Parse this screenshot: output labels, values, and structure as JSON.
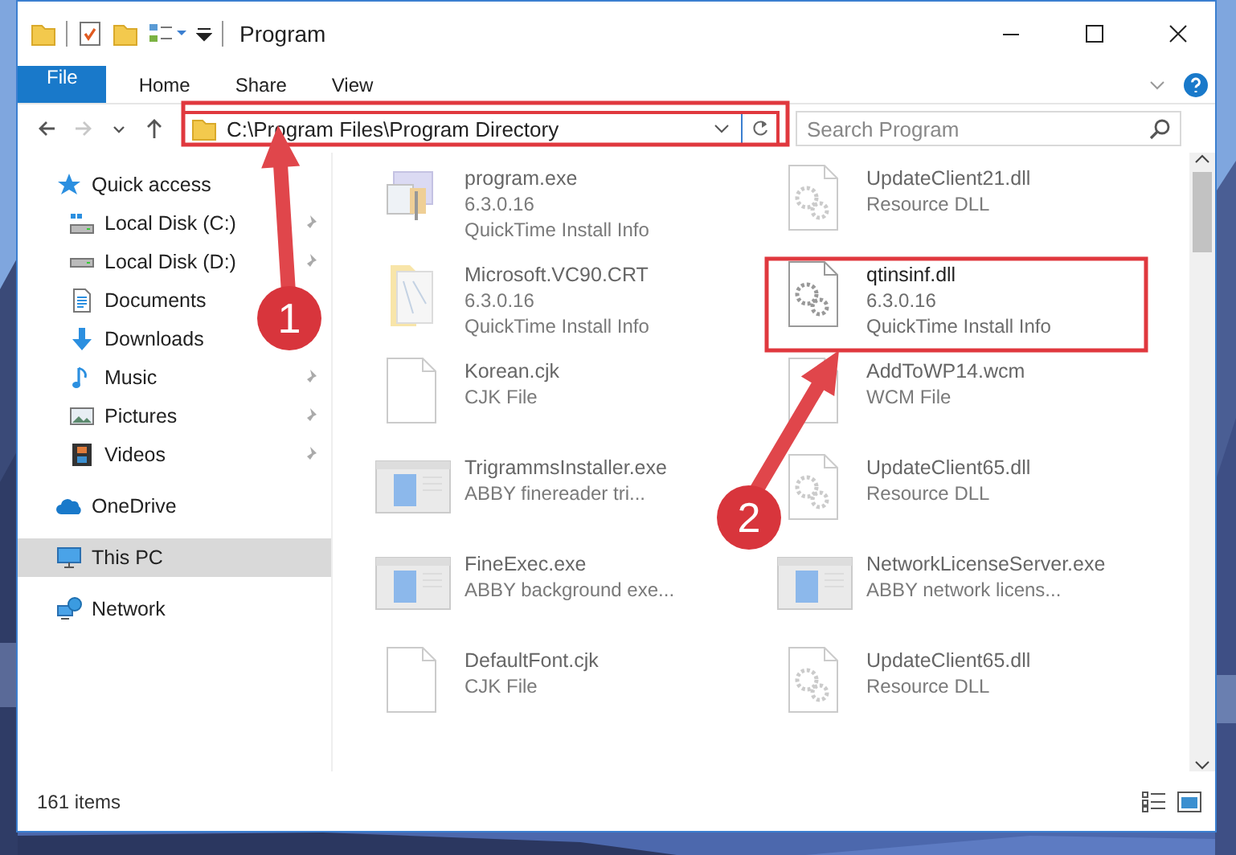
{
  "window": {
    "title": "Program"
  },
  "ribbon_tabs": [
    {
      "label": "File",
      "kind": "file"
    },
    {
      "label": "Home",
      "kind": "tab"
    },
    {
      "label": "Share",
      "kind": "tab"
    },
    {
      "label": "View",
      "kind": "tab"
    }
  ],
  "nav_buttons": [
    {
      "kind": "back",
      "disabled": false
    },
    {
      "kind": "forward",
      "disabled": true
    },
    {
      "kind": "recent",
      "disabled": false
    },
    {
      "kind": "up",
      "disabled": false
    }
  ],
  "address": {
    "path": "C:\\Program Files\\Program Directory"
  },
  "search": {
    "placeholder": "Search Program"
  },
  "sidebar": {
    "items": [
      {
        "label": "Quick access",
        "kind": "star",
        "selected": false,
        "children": [
          {
            "label": "Local Disk (C:)",
            "kind": "disk-win",
            "pinned": true,
            "selected": false
          },
          {
            "label": "Local Disk (D:)",
            "kind": "disk",
            "pinned": true,
            "selected": false
          },
          {
            "label": "Documents",
            "kind": "documents",
            "pinned": false,
            "selected": false
          },
          {
            "label": "Downloads",
            "kind": "downloads",
            "pinned": false,
            "selected": false
          },
          {
            "label": "Music",
            "kind": "music",
            "pinned": true,
            "selected": false
          },
          {
            "label": "Pictures",
            "kind": "pictures",
            "pinned": true,
            "selected": false
          },
          {
            "label": "Videos",
            "kind": "videos",
            "pinned": true,
            "selected": false
          }
        ]
      },
      {
        "label": "OneDrive",
        "kind": "cloud",
        "selected": false
      },
      {
        "label": "This PC",
        "kind": "pc",
        "selected": true
      },
      {
        "label": "Network",
        "kind": "network",
        "selected": false
      }
    ]
  },
  "files": [
    {
      "name": "program.exe",
      "details": [
        "6.3.0.16",
        "QuickTime Install Info"
      ],
      "kind": "app",
      "faded": true
    },
    {
      "name": "UpdateClient21.dll",
      "details": [
        "Resource DLL"
      ],
      "kind": "dll",
      "faded": true
    },
    {
      "name": "Microsoft.VC90.CRT",
      "details": [
        "6.3.0.16",
        "QuickTime Install Info"
      ],
      "kind": "folder",
      "faded": true
    },
    {
      "name": "qtinsinf.dll",
      "details": [
        "6.3.0.16",
        "QuickTime Install Info"
      ],
      "kind": "dll",
      "faded": false
    },
    {
      "name": "Korean.cjk",
      "details": [
        "CJK File"
      ],
      "kind": "doc",
      "faded": true
    },
    {
      "name": "AddToWP14.wcm",
      "details": [
        "WCM File"
      ],
      "kind": "doc",
      "faded": true
    },
    {
      "name": "TrigrammsInstaller.exe",
      "details": [
        "ABBY finereader tri..."
      ],
      "kind": "window",
      "faded": true
    },
    {
      "name": "UpdateClient65.dll",
      "details": [
        "Resource DLL"
      ],
      "kind": "dll",
      "faded": true
    },
    {
      "name": "FineExec.exe",
      "details": [
        "ABBY background exe..."
      ],
      "kind": "window",
      "faded": true
    },
    {
      "name": "NetworkLicenseServer.exe",
      "details": [
        "ABBY network licens..."
      ],
      "kind": "window",
      "faded": true
    },
    {
      "name": "DefaultFont.cjk",
      "details": [
        "CJK File"
      ],
      "kind": "doc",
      "faded": true
    },
    {
      "name": "UpdateClient65.dll",
      "details": [
        "Resource DLL"
      ],
      "kind": "dll",
      "faded": true
    }
  ],
  "status_bar": {
    "count": "161 items"
  },
  "annotations": [
    {
      "number": "1"
    },
    {
      "number": "2"
    }
  ]
}
